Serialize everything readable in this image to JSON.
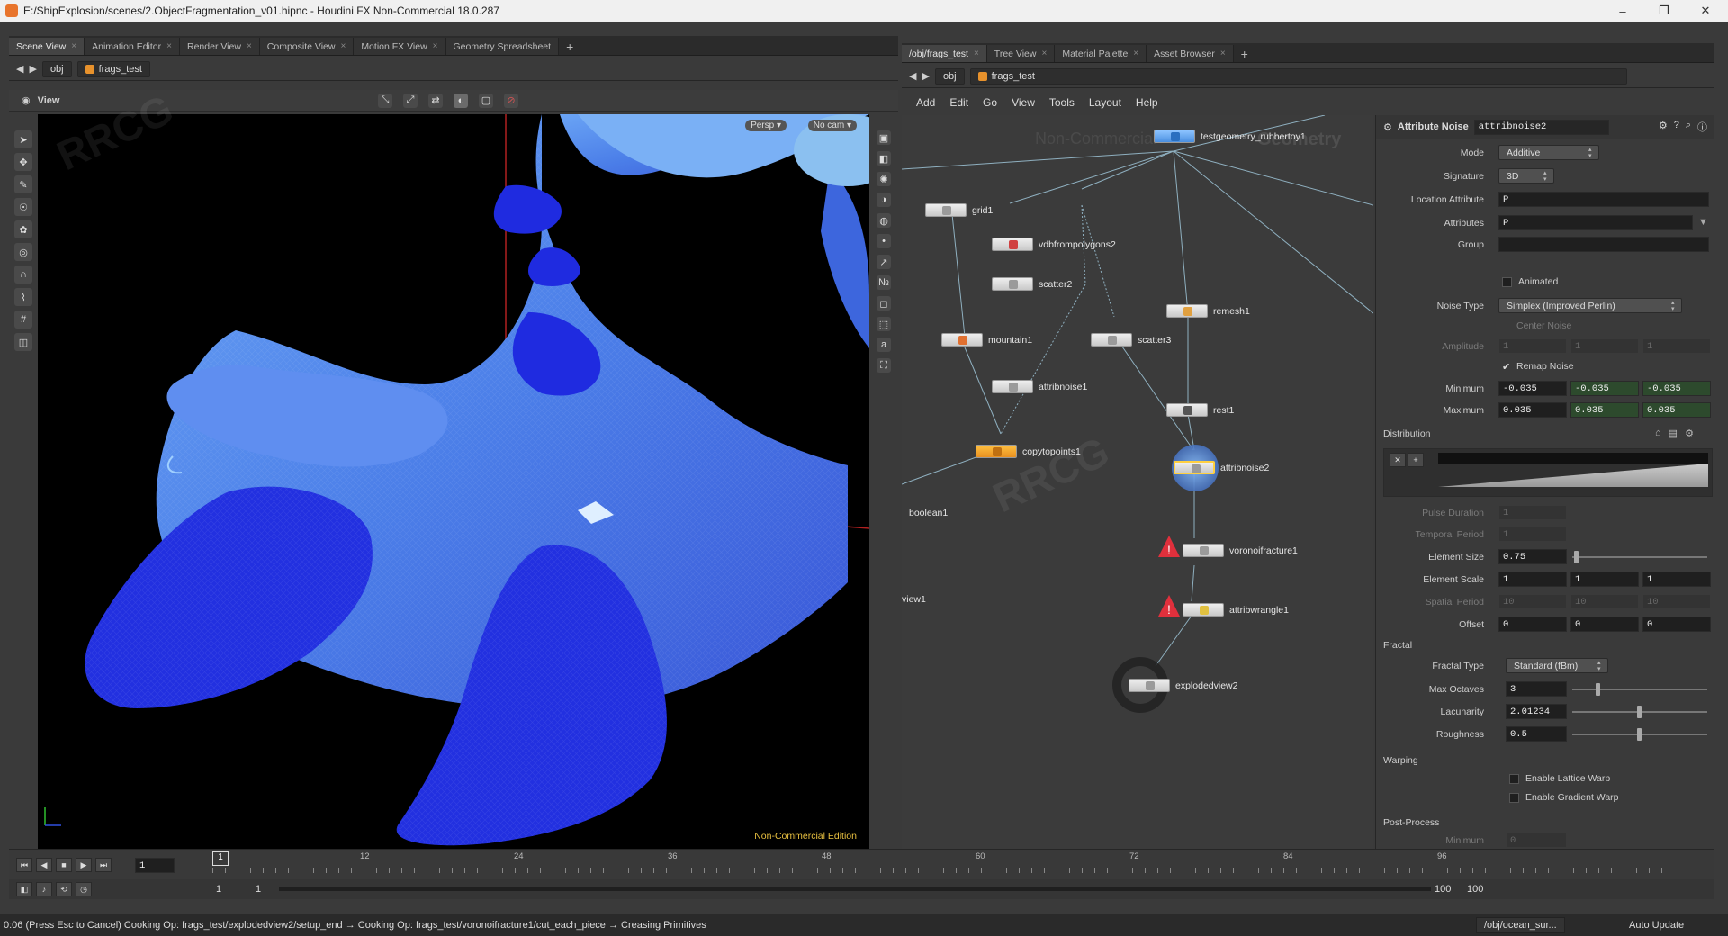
{
  "window": {
    "title": "E:/ShipExplosion/scenes/2.ObjectFragmentation_v01.hipnc - Houdini FX Non-Commercial 18.0.287",
    "min": "–",
    "max": "❐",
    "close": "✕"
  },
  "left_tabs": [
    {
      "label": "Scene View"
    },
    {
      "label": "Animation Editor"
    },
    {
      "label": "Render View"
    },
    {
      "label": "Composite View"
    },
    {
      "label": "Motion FX View"
    },
    {
      "label": "Geometry Spreadsheet"
    }
  ],
  "right_tabs": [
    {
      "label": "/obj/frags_test"
    },
    {
      "label": "Tree View"
    },
    {
      "label": "Material Palette"
    },
    {
      "label": "Asset Browser"
    }
  ],
  "tab_add": "+",
  "tab_close": "×",
  "left_path": {
    "obj": "obj",
    "node": "frags_test"
  },
  "right_path": {
    "obj": "obj",
    "node": "frags_test"
  },
  "viewport": {
    "label": "View",
    "persp": "Persp ▾",
    "cam": "No cam ▾",
    "edition": "Non-Commercial Edition",
    "bg_text": "Non-Commercial",
    "bg_text2": "Geometry"
  },
  "network_menu": [
    "Add",
    "Edit",
    "Go",
    "View",
    "Tools",
    "Layout",
    "Help"
  ],
  "nodes": [
    {
      "name": "testgeometry_rubbertoy1"
    },
    {
      "name": "grid1"
    },
    {
      "name": "vdbfrompolygons2"
    },
    {
      "name": "scatter2"
    },
    {
      "name": "remesh1"
    },
    {
      "name": "mountain1"
    },
    {
      "name": "scatter3"
    },
    {
      "name": "attribnoise1"
    },
    {
      "name": "rest1"
    },
    {
      "name": "copytopoints1"
    },
    {
      "name": "attribnoise2"
    },
    {
      "name": "boolean1"
    },
    {
      "name": "voronoifracture1"
    },
    {
      "name": "view1"
    },
    {
      "name": "attribwrangle1"
    },
    {
      "name": "explodedview2"
    }
  ],
  "params": {
    "op_type": "Attribute Noise",
    "op_name": "attribnoise2",
    "mode_label": "Mode",
    "mode": "Additive",
    "signature_label": "Signature",
    "signature": "3D",
    "location_label": "Location Attribute",
    "location": "P",
    "attributes_label": "Attributes",
    "attributes": "P",
    "group_label": "Group",
    "group": "",
    "animated_label": "Animated",
    "noise_type_label": "Noise Type",
    "noise_type": "Simplex (Improved Perlin)",
    "center_noise_label": "Center Noise",
    "amplitude_label": "Amplitude",
    "amplitude": [
      "1",
      "1",
      "1"
    ],
    "remap_label": "Remap Noise",
    "minimum_label": "Minimum",
    "minimum": [
      "-0.035",
      "-0.035",
      "-0.035"
    ],
    "maximum_label": "Maximum",
    "maximum": [
      "0.035",
      "0.035",
      "0.035"
    ],
    "distribution_label": "Distribution",
    "pulse_label": "Pulse Duration",
    "pulse": "1",
    "temporal_label": "Temporal Period",
    "temporal": "1",
    "element_size_label": "Element Size",
    "element_size": "0.75",
    "element_scale_label": "Element Scale",
    "element_scale": [
      "1",
      "1",
      "1"
    ],
    "spatial_label": "Spatial Period",
    "spatial": [
      "10",
      "10",
      "10"
    ],
    "offset_label": "Offset",
    "offset": [
      "0",
      "0",
      "0"
    ],
    "fractal_section": "Fractal",
    "fractal_type_label": "Fractal Type",
    "fractal_type": "Standard (fBm)",
    "octaves_label": "Max Octaves",
    "octaves": "3",
    "lacunarity_label": "Lacunarity",
    "lacunarity": "2.01234",
    "roughness_label": "Roughness",
    "roughness": "0.5",
    "warping_section": "Warping",
    "lattice_label": "Enable Lattice Warp",
    "gradient_label": "Enable Gradient Warp",
    "post_section": "Post-Process",
    "post_min_label": "Minimum",
    "post_min": "0"
  },
  "timeline": {
    "ticks": [
      "12",
      "24",
      "36",
      "48",
      "60",
      "72",
      "84",
      "96"
    ],
    "current_frame": "1",
    "frame_field": "1",
    "range_start": "1",
    "range_start2": "1",
    "range_end": "100",
    "range_end2": "100"
  },
  "status": {
    "message": "0:06 (Press Esc to Cancel) Cooking Op: frags_test/explodedview2/setup_end → Cooking Op: frags_test/voronoifracture1/cut_each_piece → Creasing Primitives",
    "path": "/obj/ocean_sur...",
    "update": "Auto Update"
  },
  "colors": {
    "accent": "#e8922c",
    "mesh_blue": "#2230e0",
    "mesh_light": "#5a8ff0",
    "warning": "#e0303c"
  }
}
